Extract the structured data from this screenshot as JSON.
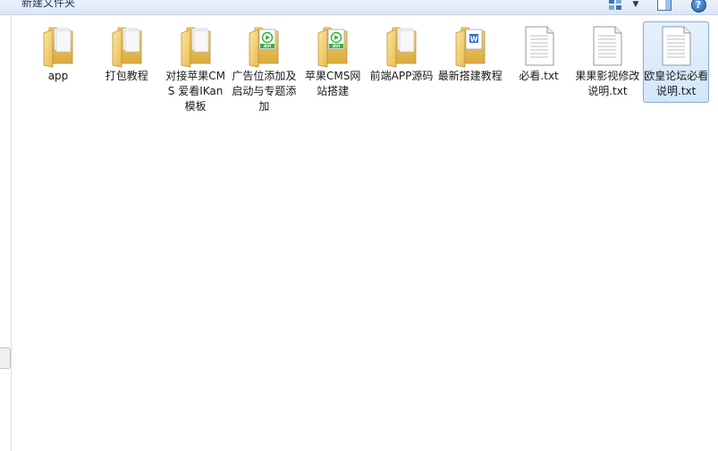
{
  "window": {
    "title": "新建文件夹"
  },
  "toolbar": {
    "view_icon": "change-view-icon",
    "dropdown_icon": "chevron-down-icon",
    "preview_pane_icon": "preview-pane-icon",
    "help_icon": "help-icon",
    "help_label": "?"
  },
  "files": [
    {
      "name": "app",
      "type": "folder",
      "icon": "folder-icon"
    },
    {
      "name": "打包教程",
      "type": "folder",
      "icon": "folder-icon"
    },
    {
      "name": "对接苹果CMS 爱看IKan模板",
      "type": "folder",
      "icon": "folder-icon"
    },
    {
      "name": "广告位添加及启动与专题添加",
      "type": "folder",
      "icon": "folder-video-icon"
    },
    {
      "name": "苹果CMS网站搭建",
      "type": "folder",
      "icon": "folder-video-icon"
    },
    {
      "name": "前端APP源码",
      "type": "folder",
      "icon": "folder-icon"
    },
    {
      "name": "最新搭建教程",
      "type": "folder",
      "icon": "folder-doc-icon"
    },
    {
      "name": "必看.txt",
      "type": "txt",
      "icon": "text-file-icon"
    },
    {
      "name": "果果影视修改说明.txt",
      "type": "txt",
      "icon": "text-file-icon"
    },
    {
      "name": "欧皇论坛必看说明.txt",
      "type": "txt",
      "icon": "text-file-icon",
      "selected": true
    }
  ],
  "colors": {
    "selection_bg": "#d3e6fb",
    "selection_border": "#84acdd",
    "folder_yellow": "#f5cf6a",
    "video_badge": "#3cae3c"
  }
}
